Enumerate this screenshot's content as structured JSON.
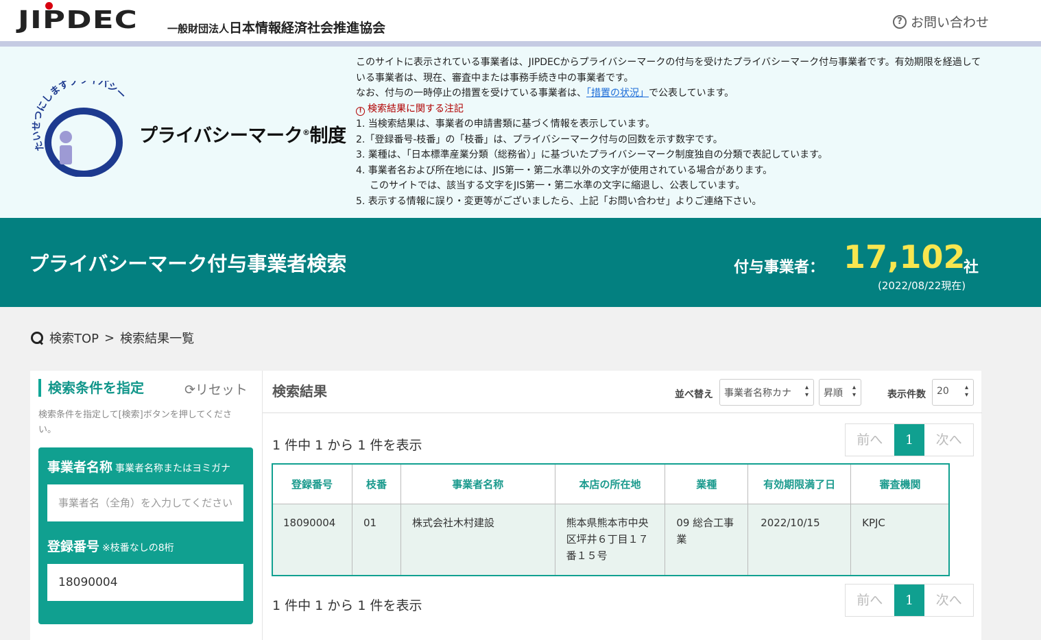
{
  "header": {
    "logo_text": "JIPDEC",
    "org_prefix": "一般財団法人",
    "org_name": "日本情報経済社会推進協会",
    "contact_label": "お問い合わせ"
  },
  "pmark": {
    "arc_text": "たいせつにしますプライバシー",
    "title": "プライバシーマーク",
    "title_reg": "®",
    "title_suffix": "制度"
  },
  "notice": {
    "line1": "このサイトに表示されている事業者は、JIPDECからプライバシーマークの付与を受けたプライバシーマーク付与事業者です。有効期限を経過している事業者は、現在、審査中または事務手続き中の事業者です。",
    "line2_pre": "なお、付与の一時停止の措置を受けている事業者は、",
    "line2_link": "「措置の状況」",
    "line2_post": "で公表しています。",
    "warn_heading": "検索結果に関する注記",
    "items": [
      "1. 当検索結果は、事業者の申請書類に基づく情報を表示しています。",
      "2.「登録番号-枝番」の「枝番」は、プライバシーマーク付与の回数を示す数字です。",
      "3. 業種は、「日本標準産業分類（総務省）」に基づいたプライバシーマーク制度独自の分類で表記しています。",
      "4. 事業者名および所在地には、JIS第一・第二水準以外の文字が使用されている場合があります。",
      "このサイトでは、該当する文字をJIS第一・第二水準の文字に縮退し、公表しています。",
      "5. 表示する情報に誤り・変更等がございましたら、上記「お問い合わせ」よりご連絡下さい。"
    ]
  },
  "banner": {
    "title": "プライバシーマーク付与事業者検索",
    "count_label": "付与事業者：",
    "count": "17,102",
    "count_unit": "社",
    "as_of": "(2022/08/22現在)"
  },
  "breadcrumb": {
    "top": "検索TOP",
    "sep": ">",
    "current": "検索結果一覧"
  },
  "conditions": {
    "title": "検索条件を指定",
    "reset": "リセット",
    "hint": "検索条件を指定して[検索]ボタンを押してください。",
    "company_label": "事業者名称",
    "company_sub": "事業者名称またはヨミガナ",
    "company_placeholder": "事業者名（全角）を入力してください",
    "company_value": "",
    "regno_label": "登録番号",
    "regno_sub": "※枝番なしの8桁",
    "regno_value": "18090004"
  },
  "results": {
    "title": "検索結果",
    "sort_label": "並べ替え",
    "sort_value": "事業者名称カナ",
    "order_value": "昇順",
    "count_label": "表示件数",
    "count_value": "20",
    "summary": "1 件中 1 から 1 件を表示",
    "pager": {
      "prev": "前へ",
      "current": "1",
      "next": "次へ"
    },
    "columns": [
      "登録番号",
      "枝番",
      "事業者名称",
      "本店の所在地",
      "業種",
      "有効期限満了日",
      "審査機関"
    ],
    "rows": [
      {
        "regno": "18090004",
        "branch": "01",
        "name": "株式会社木村建設",
        "address": "熊本県熊本市中央区坪井６丁目１７番１５号",
        "industry": "09 総合工事業",
        "expiry": "2022/10/15",
        "agency": "KPJC"
      }
    ]
  },
  "colors": {
    "teal": "#038080",
    "accent_green": "#10a090",
    "count_yellow": "#f8e64f"
  }
}
